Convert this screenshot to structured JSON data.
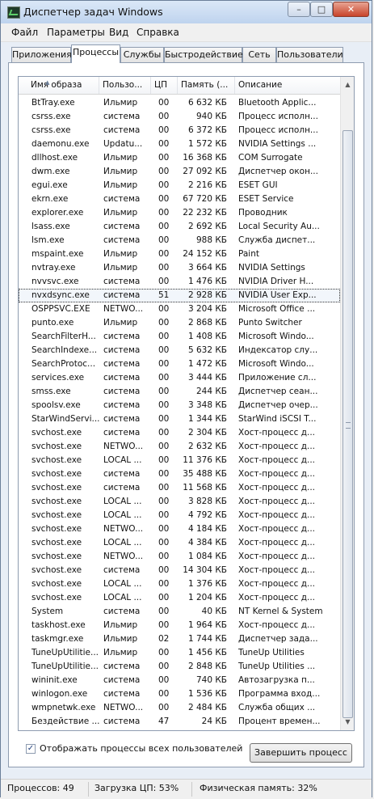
{
  "window": {
    "title": "Диспетчер задач Windows"
  },
  "controls": {
    "min": "–",
    "max": "□",
    "close": "✕"
  },
  "menu": [
    "Файл",
    "Параметры",
    "Вид",
    "Справка"
  ],
  "tabs": [
    "Приложения",
    "Процессы",
    "Службы",
    "Быстродействие",
    "Сеть",
    "Пользователи"
  ],
  "active_tab": "Процессы",
  "columns": [
    "Имя образа",
    "Пользо...",
    "ЦП",
    "Память (...",
    "Описание"
  ],
  "rows": [
    {
      "name": "BtTray.exe",
      "user": "Ильмир",
      "cpu": "00",
      "mem": "6 632 КБ",
      "desc": "Bluetooth Applic..."
    },
    {
      "name": "csrss.exe",
      "user": "система",
      "cpu": "00",
      "mem": "940 КБ",
      "desc": "Процесс исполн..."
    },
    {
      "name": "csrss.exe",
      "user": "система",
      "cpu": "00",
      "mem": "6 372 КБ",
      "desc": "Процесс исполн..."
    },
    {
      "name": "daemonu.exe",
      "user": "Updatu...",
      "cpu": "00",
      "mem": "1 572 КБ",
      "desc": "NVIDIA Settings ..."
    },
    {
      "name": "dllhost.exe",
      "user": "Ильмир",
      "cpu": "00",
      "mem": "16 368 КБ",
      "desc": "COM Surrogate"
    },
    {
      "name": "dwm.exe",
      "user": "Ильмир",
      "cpu": "00",
      "mem": "27 092 КБ",
      "desc": "Диспетчер окон..."
    },
    {
      "name": "egui.exe",
      "user": "Ильмир",
      "cpu": "00",
      "mem": "2 216 КБ",
      "desc": "ESET GUI"
    },
    {
      "name": "ekrn.exe",
      "user": "система",
      "cpu": "00",
      "mem": "67 720 КБ",
      "desc": "ESET Service"
    },
    {
      "name": "explorer.exe",
      "user": "Ильмир",
      "cpu": "00",
      "mem": "22 232 КБ",
      "desc": "Проводник"
    },
    {
      "name": "lsass.exe",
      "user": "система",
      "cpu": "00",
      "mem": "2 692 КБ",
      "desc": "Local Security Au..."
    },
    {
      "name": "lsm.exe",
      "user": "система",
      "cpu": "00",
      "mem": "988 КБ",
      "desc": "Служба диспет..."
    },
    {
      "name": "mspaint.exe",
      "user": "Ильмир",
      "cpu": "00",
      "mem": "24 152 КБ",
      "desc": "Paint"
    },
    {
      "name": "nvtray.exe",
      "user": "Ильмир",
      "cpu": "00",
      "mem": "3 664 КБ",
      "desc": "NVIDIA Settings"
    },
    {
      "name": "nvvsvc.exe",
      "user": "система",
      "cpu": "00",
      "mem": "1 476 КБ",
      "desc": "NVIDIA Driver H..."
    },
    {
      "name": "nvxdsync.exe",
      "user": "система",
      "cpu": "51",
      "mem": "2 928 КБ",
      "desc": "NVIDIA User Exp...",
      "selected": true
    },
    {
      "name": "OSPPSVC.EXE",
      "user": "NETWO...",
      "cpu": "00",
      "mem": "3 204 КБ",
      "desc": "Microsoft Office ..."
    },
    {
      "name": "punto.exe",
      "user": "Ильмир",
      "cpu": "00",
      "mem": "2 868 КБ",
      "desc": "Punto Switcher"
    },
    {
      "name": "SearchFilterH...",
      "user": "система",
      "cpu": "00",
      "mem": "1 408 КБ",
      "desc": "Microsoft Windo..."
    },
    {
      "name": "SearchIndexe...",
      "user": "система",
      "cpu": "00",
      "mem": "5 632 КБ",
      "desc": "Индексатор слу..."
    },
    {
      "name": "SearchProtoc...",
      "user": "система",
      "cpu": "00",
      "mem": "1 472 КБ",
      "desc": "Microsoft Windo..."
    },
    {
      "name": "services.exe",
      "user": "система",
      "cpu": "00",
      "mem": "3 444 КБ",
      "desc": "Приложение сл..."
    },
    {
      "name": "smss.exe",
      "user": "система",
      "cpu": "00",
      "mem": "244 КБ",
      "desc": "Диспетчер сеан..."
    },
    {
      "name": "spoolsv.exe",
      "user": "система",
      "cpu": "00",
      "mem": "3 348 КБ",
      "desc": "Диспетчер очер..."
    },
    {
      "name": "StarWindServi...",
      "user": "система",
      "cpu": "00",
      "mem": "1 344 КБ",
      "desc": "StarWind iSCSI T..."
    },
    {
      "name": "svchost.exe",
      "user": "система",
      "cpu": "00",
      "mem": "2 304 КБ",
      "desc": "Хост-процесс д..."
    },
    {
      "name": "svchost.exe",
      "user": "NETWO...",
      "cpu": "00",
      "mem": "2 632 КБ",
      "desc": "Хост-процесс д..."
    },
    {
      "name": "svchost.exe",
      "user": "LOCAL ...",
      "cpu": "00",
      "mem": "11 376 КБ",
      "desc": "Хост-процесс д..."
    },
    {
      "name": "svchost.exe",
      "user": "система",
      "cpu": "00",
      "mem": "35 488 КБ",
      "desc": "Хост-процесс д..."
    },
    {
      "name": "svchost.exe",
      "user": "система",
      "cpu": "00",
      "mem": "11 568 КБ",
      "desc": "Хост-процесс д..."
    },
    {
      "name": "svchost.exe",
      "user": "LOCAL ...",
      "cpu": "00",
      "mem": "3 828 КБ",
      "desc": "Хост-процесс д..."
    },
    {
      "name": "svchost.exe",
      "user": "LOCAL ...",
      "cpu": "00",
      "mem": "4 792 КБ",
      "desc": "Хост-процесс д..."
    },
    {
      "name": "svchost.exe",
      "user": "NETWO...",
      "cpu": "00",
      "mem": "4 184 КБ",
      "desc": "Хост-процесс д..."
    },
    {
      "name": "svchost.exe",
      "user": "LOCAL ...",
      "cpu": "00",
      "mem": "4 384 КБ",
      "desc": "Хост-процесс д..."
    },
    {
      "name": "svchost.exe",
      "user": "NETWO...",
      "cpu": "00",
      "mem": "1 084 КБ",
      "desc": "Хост-процесс д..."
    },
    {
      "name": "svchost.exe",
      "user": "система",
      "cpu": "00",
      "mem": "14 304 КБ",
      "desc": "Хост-процесс д..."
    },
    {
      "name": "svchost.exe",
      "user": "LOCAL ...",
      "cpu": "00",
      "mem": "1 376 КБ",
      "desc": "Хост-процесс д..."
    },
    {
      "name": "svchost.exe",
      "user": "LOCAL ...",
      "cpu": "00",
      "mem": "1 204 КБ",
      "desc": "Хост-процесс д..."
    },
    {
      "name": "System",
      "user": "система",
      "cpu": "00",
      "mem": "40 КБ",
      "desc": "NT Kernel & System"
    },
    {
      "name": "taskhost.exe",
      "user": "Ильмир",
      "cpu": "00",
      "mem": "1 964 КБ",
      "desc": "Хост-процесс д..."
    },
    {
      "name": "taskmgr.exe",
      "user": "Ильмир",
      "cpu": "02",
      "mem": "1 744 КБ",
      "desc": "Диспетчер зада..."
    },
    {
      "name": "TuneUpUtilitie...",
      "user": "Ильмир",
      "cpu": "00",
      "mem": "1 456 КБ",
      "desc": "TuneUp Utilities"
    },
    {
      "name": "TuneUpUtilitie...",
      "user": "система",
      "cpu": "00",
      "mem": "2 848 КБ",
      "desc": "TuneUp Utilities ..."
    },
    {
      "name": "wininit.exe",
      "user": "система",
      "cpu": "00",
      "mem": "740 КБ",
      "desc": "Автозагрузка п..."
    },
    {
      "name": "winlogon.exe",
      "user": "система",
      "cpu": "00",
      "mem": "1 536 КБ",
      "desc": "Программа вход..."
    },
    {
      "name": "wmpnetwk.exe",
      "user": "NETWO...",
      "cpu": "00",
      "mem": "2 484 КБ",
      "desc": "Служба общих ..."
    },
    {
      "name": "Бездействие ...",
      "user": "система",
      "cpu": "47",
      "mem": "24 КБ",
      "desc": "Процент времен..."
    }
  ],
  "show_all_checkbox": {
    "label": "Отображать процессы всех пользователей",
    "checked": true
  },
  "end_process_label": "Завершить процесс",
  "status": {
    "processes": "Процессов: 49",
    "cpu": "Загрузка ЦП: 53%",
    "memory": "Физическая память: 32%"
  }
}
